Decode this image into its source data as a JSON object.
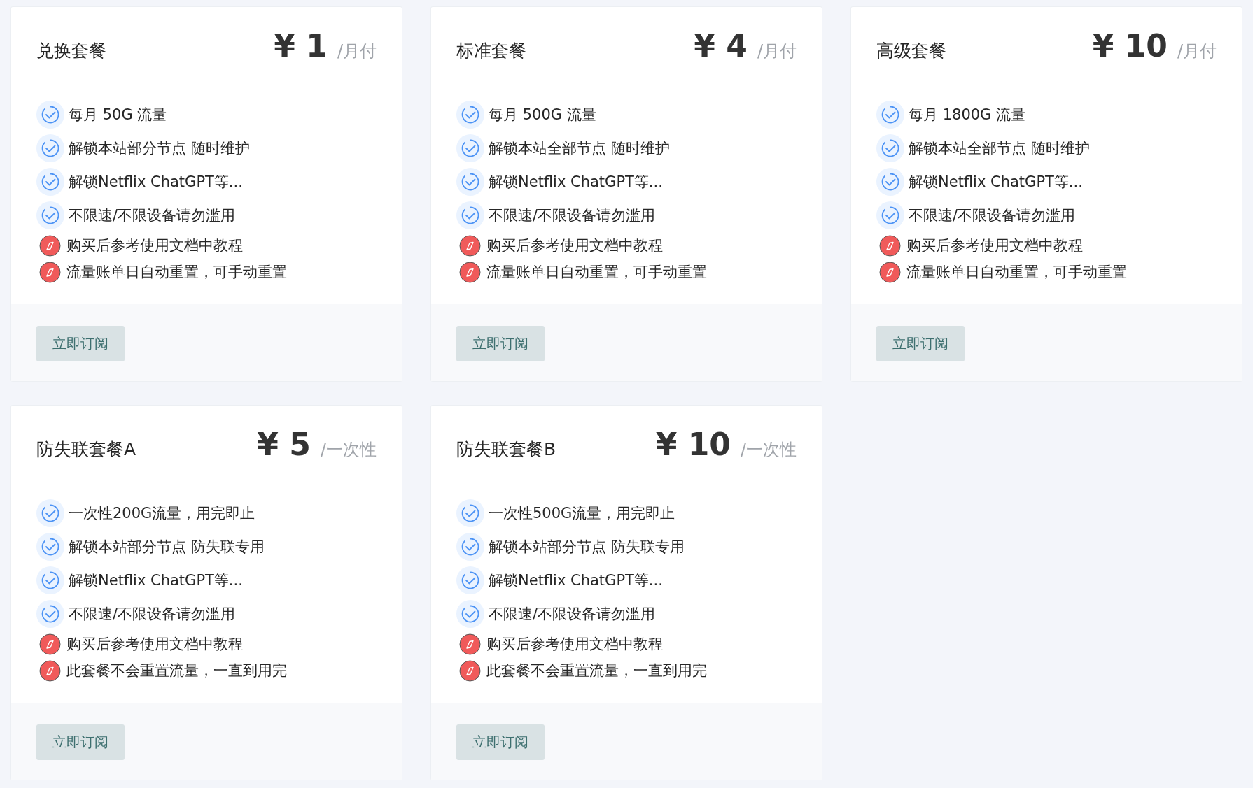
{
  "plans": [
    {
      "name": "兑换套餐",
      "price": "¥ 1",
      "period": "/月付",
      "features": [
        {
          "kind": "check",
          "text": "每月 50G 流量"
        },
        {
          "kind": "check",
          "text": "解锁本站部分节点 随时维护"
        },
        {
          "kind": "check",
          "text": "解锁Netflix ChatGPT等..."
        },
        {
          "kind": "check",
          "text": "不限速/不限设备请勿滥用"
        },
        {
          "kind": "note",
          "text": "购买后参考使用文档中教程"
        },
        {
          "kind": "note",
          "text": "流量账单日自动重置，可手动重置"
        }
      ],
      "button": "立即订阅"
    },
    {
      "name": "标准套餐",
      "price": "¥ 4",
      "period": "/月付",
      "features": [
        {
          "kind": "check",
          "text": "每月 500G 流量"
        },
        {
          "kind": "check",
          "text": "解锁本站全部节点 随时维护"
        },
        {
          "kind": "check",
          "text": "解锁Netflix ChatGPT等..."
        },
        {
          "kind": "check",
          "text": "不限速/不限设备请勿滥用"
        },
        {
          "kind": "note",
          "text": "购买后参考使用文档中教程"
        },
        {
          "kind": "note",
          "text": "流量账单日自动重置，可手动重置"
        }
      ],
      "button": "立即订阅"
    },
    {
      "name": "高级套餐",
      "price": "¥ 10",
      "period": "/月付",
      "features": [
        {
          "kind": "check",
          "text": "每月 1800G 流量"
        },
        {
          "kind": "check",
          "text": "解锁本站全部节点 随时维护"
        },
        {
          "kind": "check",
          "text": "解锁Netflix ChatGPT等..."
        },
        {
          "kind": "check",
          "text": "不限速/不限设备请勿滥用"
        },
        {
          "kind": "note",
          "text": "购买后参考使用文档中教程"
        },
        {
          "kind": "note",
          "text": "流量账单日自动重置，可手动重置"
        }
      ],
      "button": "立即订阅"
    },
    {
      "name": "防失联套餐A",
      "price": "¥ 5",
      "period": "/一次性",
      "features": [
        {
          "kind": "check",
          "text": "一次性200G流量，用完即止"
        },
        {
          "kind": "check",
          "text": "解锁本站部分节点 防失联专用"
        },
        {
          "kind": "check",
          "text": "解锁Netflix ChatGPT等..."
        },
        {
          "kind": "check",
          "text": "不限速/不限设备请勿滥用"
        },
        {
          "kind": "note",
          "text": "购买后参考使用文档中教程"
        },
        {
          "kind": "note",
          "text": "此套餐不会重置流量，一直到用完"
        }
      ],
      "button": "立即订阅"
    },
    {
      "name": "防失联套餐B",
      "price": "¥ 10",
      "period": "/一次性",
      "features": [
        {
          "kind": "check",
          "text": "一次性500G流量，用完即止"
        },
        {
          "kind": "check",
          "text": "解锁本站部分节点 防失联专用"
        },
        {
          "kind": "check",
          "text": "解锁Netflix ChatGPT等..."
        },
        {
          "kind": "check",
          "text": "不限速/不限设备请勿滥用"
        },
        {
          "kind": "note",
          "text": "购买后参考使用文档中教程"
        },
        {
          "kind": "note",
          "text": "此套餐不会重置流量，一直到用完"
        }
      ],
      "button": "立即订阅"
    }
  ]
}
